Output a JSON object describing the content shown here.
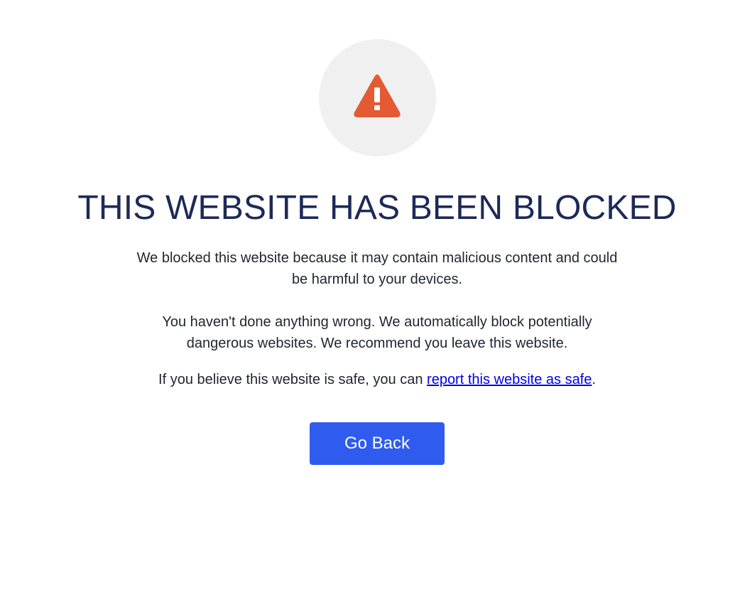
{
  "icon": {
    "name": "warning-triangle-icon",
    "color": "#e35a33",
    "circle_color": "#f0f0f0"
  },
  "title": "THIS WEBSITE HAS BEEN BLOCKED",
  "paragraphs": {
    "p1": "We blocked this website because it may contain malicious content and could be harmful to your devices.",
    "p2": "You haven't done anything wrong. We automatically block potentially dangerous websites. We recommend you leave this website.",
    "p3_prefix": "If you believe this website is safe, you can ",
    "p3_link": "report this website as safe",
    "p3_suffix": "."
  },
  "button": {
    "label": "Go Back",
    "color": "#2f5cef"
  },
  "colors": {
    "title": "#1d2a57",
    "text": "#222631",
    "link": "#0000ee"
  }
}
